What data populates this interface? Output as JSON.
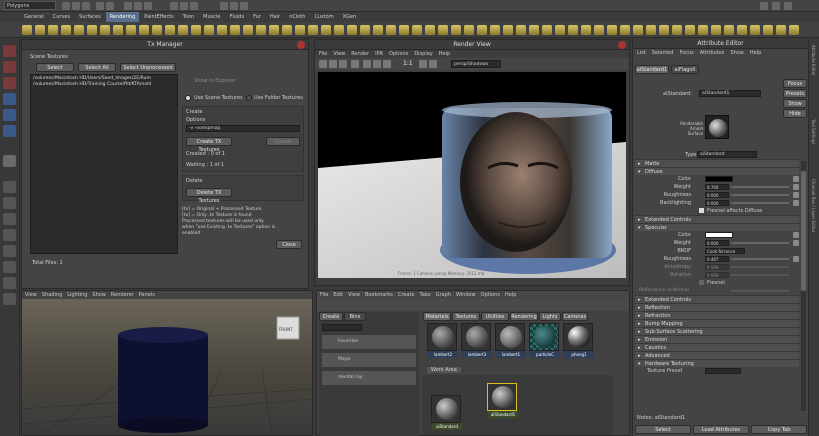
{
  "topbar": {
    "workspace": "Polygons"
  },
  "shelf_tabs": [
    "General",
    "Curves",
    "Surfaces",
    "Rendering",
    "PaintEffects",
    "Toon",
    "Muscle",
    "Fluids",
    "Fur",
    "Hair",
    "nCloth",
    "Custom",
    "XGen"
  ],
  "active_shelf_tab": "Rendering",
  "tx_manager": {
    "title": "Tx Manager",
    "scene_textures_label": "Scene Textures",
    "select_btn": "Select",
    "select_all_btn": "Select All",
    "select_unprocessed_btn": "Select Unprocessed",
    "file_lines": [
      "/volumes/Macintosh HD/Users/Saed_Images/2E/Rum",
      "/volumes/Macintosh HD/Training Course/ffd/KTArnold"
    ],
    "show_in_explorer": "Show in Explorer",
    "radio_scene": "Use Scene Textures",
    "radio_folder": "Use Folder Textures",
    "create_label": "Create",
    "options_label": "Options",
    "options_value": "-v -nomipmap",
    "create_btn": "Create TX Textures",
    "cancel_btn": "Cancel",
    "created_label": "Created : 0 of 1",
    "waiting_label": "Waiting : 1 of 1",
    "delete_label": "Delete",
    "delete_btn": "Delete TX Textures",
    "note_lines": [
      "[tx] = Original + Processed Texture",
      "[tx] = Only .tx Texture is found",
      "Processed textures will be used only",
      "when \"use Existing .tx Textures\" option is",
      "enabled"
    ],
    "total_files": "Total Files: 1",
    "close_btn": "Close"
  },
  "render_view": {
    "title": "Render View",
    "menu": [
      "File",
      "View",
      "Render",
      "IPR",
      "Options",
      "Display",
      "Help"
    ],
    "ratio": "1:1",
    "camera_dropdown": "persp/Shadows",
    "caption": "Frame: 1   Camera: persp   Memory: 3512 mb"
  },
  "attr_editor": {
    "title": "Attribute Editor",
    "menu": [
      "List",
      "Selected",
      "Focus",
      "Attributes",
      "Show",
      "Help"
    ],
    "tabs": [
      "aiStandard1",
      "aiFlagsX"
    ],
    "node_label": "aiStandard:",
    "node_value": "aiStandard1",
    "focus_btn": "Focus",
    "presets_btn": "Presets",
    "show_btn": "Show",
    "hide_btn": "Hide",
    "swatch_caption_1": "Renderable",
    "swatch_caption_2": "Arnold",
    "swatch_caption_3": "Surface",
    "type_label": "Type",
    "type_value": "aiStandard",
    "sections": {
      "matte": "Matte",
      "diffuse": "Diffuse",
      "extended_controls": "Extended Controls",
      "specular": "Specular",
      "ext_specular": "Extended Controls",
      "reflection": "Reflection",
      "refraction": "Refraction",
      "bump_mapping": "Bump Mapping",
      "sss": "Sub-Surface Scattering",
      "emission": "Emission",
      "caustics": "Caustics",
      "advanced": "Advanced",
      "hardware_texturing": "Hardware Texturing"
    },
    "diffuse_rows": [
      {
        "label": "Color",
        "value": ""
      },
      {
        "label": "Weight",
        "value": "0.700"
      },
      {
        "label": "Roughness",
        "value": "0.000"
      },
      {
        "label": "Backlighting",
        "value": "0.000"
      }
    ],
    "fresnel_affect": "Fresnel affects Diffuse",
    "specular_rows": [
      {
        "label": "Color",
        "value": ""
      },
      {
        "label": "Weight",
        "value": "0.000"
      },
      {
        "label": "BRDF",
        "value": "Cook-Torrance"
      },
      {
        "label": "Roughness",
        "value": "0.467"
      },
      {
        "label": "Anisotropy",
        "value": "0.500"
      },
      {
        "label": "Rotation",
        "value": "0.000"
      }
    ],
    "fresnel": "Fresnel",
    "reflectance": "Reflectance at Normal",
    "texturing_preset": "Texture Preset",
    "notes_label": "Notes: aiStandard1",
    "bottom_btns": [
      "Select",
      "Load Attributes",
      "Copy Tab"
    ]
  },
  "viewport": {
    "menu": [
      "View",
      "Shading",
      "Lighting",
      "Show",
      "Renderer",
      "Panels"
    ],
    "cube_label": "FRONT"
  },
  "hypershade": {
    "menu": [
      "File",
      "Edit",
      "View",
      "Bookmarks",
      "Create",
      "Tabs",
      "Graph",
      "Window",
      "Options",
      "Help"
    ],
    "left_tabs": [
      "Create",
      "Bins"
    ],
    "item_captions": [
      "Favorites",
      "Maya",
      "mental ray"
    ],
    "tabs": [
      "Materials",
      "Textures",
      "Utilities",
      "Rendering",
      "Lights",
      "Cameras"
    ],
    "swatches": [
      "lambert2",
      "lambert3",
      "lambert1",
      "particleC",
      "phong1"
    ],
    "work_area_label": "Work Area",
    "work_swatches": [
      "aiStandard",
      "aiStandard1"
    ]
  },
  "side_strip": [
    "Attribute Editor",
    "Tool Settings",
    "Channel Box / Layer Editor"
  ]
}
